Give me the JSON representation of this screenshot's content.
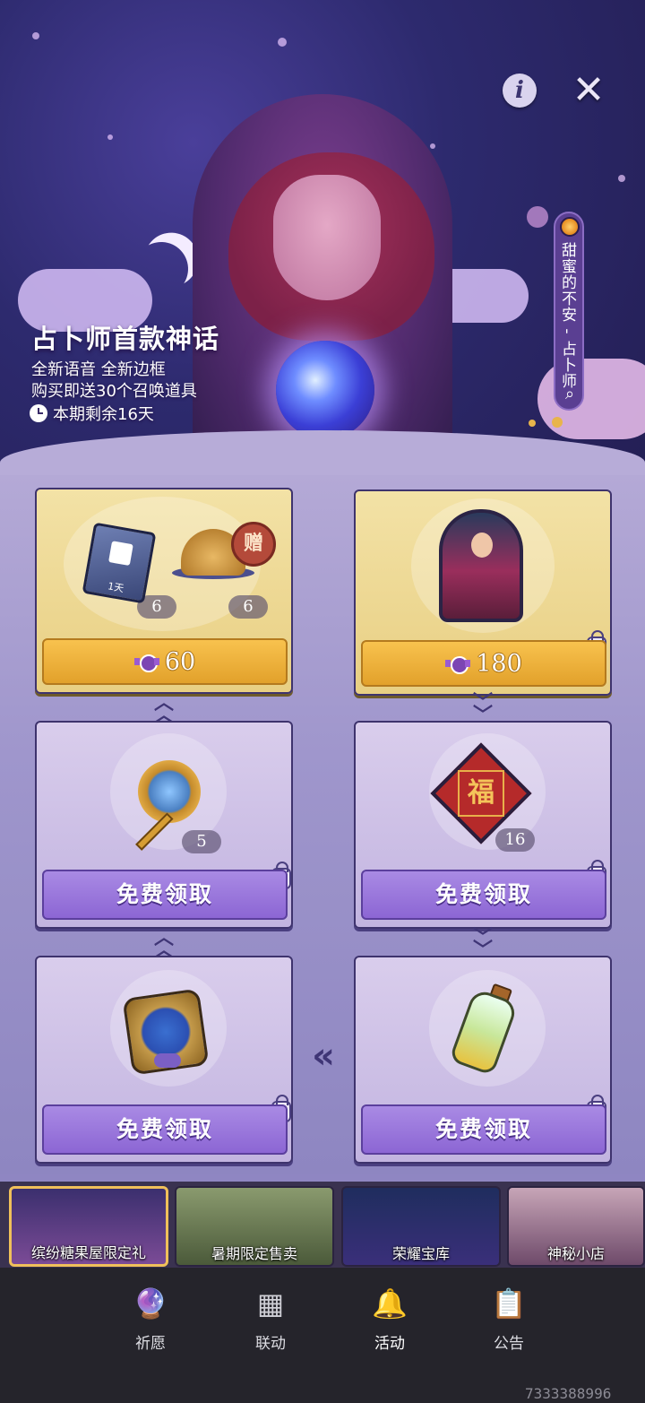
{
  "banner": {
    "title": "占卜师首款神话",
    "line1": "全新语音 全新边框",
    "line2": "购买即送30个召唤道具",
    "timer": "本期剩余16天",
    "side_tab_label": "甜蜜的不安 - 占卜师"
  },
  "packs": [
    {
      "items": [
        {
          "icon": "ticket-icon",
          "label": "1天",
          "count": "6"
        },
        {
          "icon": "sand-icon",
          "count": "6",
          "badge": "赠"
        }
      ],
      "price": "60",
      "currency_icon": "candy-icon"
    },
    {
      "items": [
        {
          "icon": "skin-portrait-icon"
        }
      ],
      "price": "180",
      "currency_icon": "candy-icon",
      "locked": true
    },
    {
      "items": [
        {
          "icon": "key-icon",
          "count": "5"
        }
      ],
      "button": "免费领取",
      "locked": true
    },
    {
      "items": [
        {
          "icon": "fu-card-icon",
          "count": "16"
        }
      ],
      "button": "免费领取",
      "locked": true
    },
    {
      "items": [
        {
          "icon": "candy-tablet-icon"
        }
      ],
      "button": "免费领取",
      "locked": true
    },
    {
      "items": [
        {
          "icon": "bottle-icon"
        }
      ],
      "button": "免费领取",
      "locked": true
    }
  ],
  "events": [
    {
      "label": "缤纷糖果屋限定礼",
      "active": true
    },
    {
      "label": "暑期限定售卖"
    },
    {
      "label": "荣耀宝库"
    },
    {
      "label": "神秘小店"
    }
  ],
  "nav": [
    {
      "label": "祈愿",
      "icon": "crystal-ball-icon"
    },
    {
      "label": "联动",
      "icon": "collab-icon"
    },
    {
      "label": "活动",
      "icon": "bell-icon",
      "active": true
    },
    {
      "label": "公告",
      "icon": "notice-icon"
    }
  ],
  "watermark": "7333388996",
  "colors": {
    "gold_button": "#e2a12b",
    "purple_button": "#8c66d4",
    "accent": "#f0c05a"
  }
}
